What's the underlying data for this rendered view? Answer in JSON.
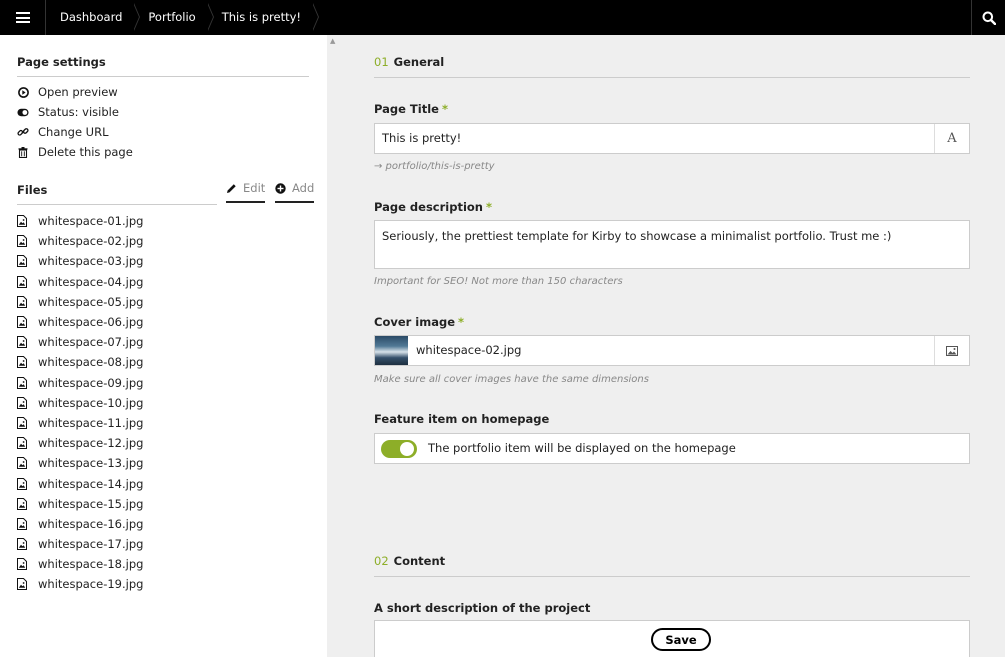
{
  "topbar": {
    "breadcrumbs": [
      "Dashboard",
      "Portfolio",
      "This is pretty!"
    ]
  },
  "sidebar": {
    "page_settings_title": "Page settings",
    "actions": [
      {
        "label": "Open preview",
        "icon": "play-circle-icon"
      },
      {
        "label": "Status: visible",
        "icon": "toggle-icon"
      },
      {
        "label": "Change URL",
        "icon": "link-icon"
      },
      {
        "label": "Delete this page",
        "icon": "trash-icon"
      }
    ],
    "files_title": "Files",
    "edit_label": "Edit",
    "add_label": "Add",
    "files": [
      "whitespace-01.jpg",
      "whitespace-02.jpg",
      "whitespace-03.jpg",
      "whitespace-04.jpg",
      "whitespace-05.jpg",
      "whitespace-06.jpg",
      "whitespace-07.jpg",
      "whitespace-08.jpg",
      "whitespace-09.jpg",
      "whitespace-10.jpg",
      "whitespace-11.jpg",
      "whitespace-12.jpg",
      "whitespace-13.jpg",
      "whitespace-14.jpg",
      "whitespace-15.jpg",
      "whitespace-16.jpg",
      "whitespace-17.jpg",
      "whitespace-18.jpg",
      "whitespace-19.jpg"
    ]
  },
  "main": {
    "section1": {
      "num": "01",
      "title": "General"
    },
    "page_title": {
      "label": "Page Title",
      "required": "*",
      "value": "This is pretty!",
      "help": "→ portfolio/this-is-pretty",
      "icon_glyph": "A"
    },
    "page_description": {
      "label": "Page description",
      "required": "*",
      "value": "Seriously, the prettiest template for Kirby to showcase a minimalist portfolio. Trust me :)",
      "help": "Important for SEO! Not more than 150 characters"
    },
    "cover_image": {
      "label": "Cover image",
      "required": "*",
      "value": "whitespace-02.jpg",
      "help": "Make sure all cover images have the same dimensions"
    },
    "feature": {
      "label": "Feature item on homepage",
      "text": "The portfolio item will be displayed on the homepage",
      "on": true
    },
    "section2": {
      "num": "02",
      "title": "Content"
    },
    "short_description": {
      "label": "A short description of the project"
    },
    "save_label": "Save"
  },
  "colors": {
    "accent": "#8dae28",
    "topbar": "#000000",
    "sidebar": "#ffffff",
    "main_bg": "#efefef"
  }
}
